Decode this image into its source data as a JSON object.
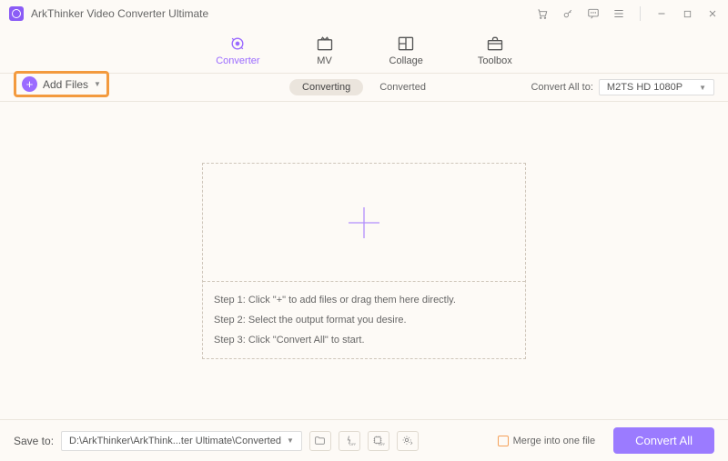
{
  "title": "ArkThinker Video Converter Ultimate",
  "nav": {
    "converter": "Converter",
    "mv": "MV",
    "collage": "Collage",
    "toolbox": "Toolbox"
  },
  "toolbar": {
    "add_files": "Add Files",
    "subtabs": {
      "converting": "Converting",
      "converted": "Converted"
    },
    "convert_all_to_label": "Convert All to:",
    "format": "M2TS HD 1080P"
  },
  "steps": {
    "s1": "Step 1: Click \"+\" to add files or drag them here directly.",
    "s2": "Step 2: Select the output format you desire.",
    "s3": "Step 3: Click \"Convert All\" to start."
  },
  "bottom": {
    "save_to": "Save to:",
    "path": "D:\\ArkThinker\\ArkThink...ter Ultimate\\Converted",
    "merge": "Merge into one file",
    "convert_all": "Convert All"
  }
}
